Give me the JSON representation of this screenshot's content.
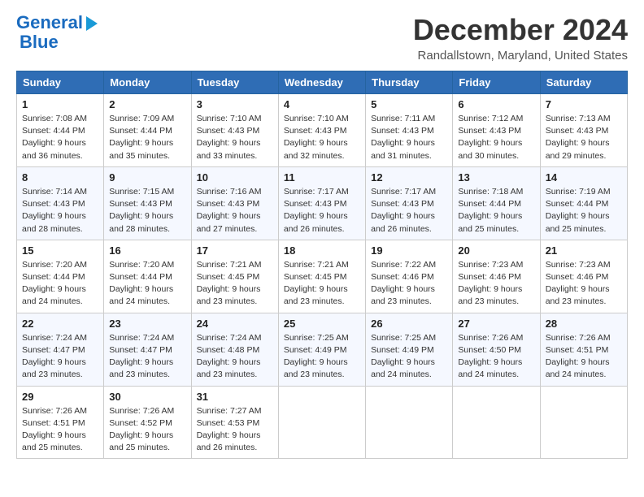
{
  "header": {
    "logo_line1": "General",
    "logo_line2": "Blue",
    "month_year": "December 2024",
    "location": "Randallstown, Maryland, United States"
  },
  "days_of_week": [
    "Sunday",
    "Monday",
    "Tuesday",
    "Wednesday",
    "Thursday",
    "Friday",
    "Saturday"
  ],
  "weeks": [
    [
      {
        "day": "1",
        "info": "Sunrise: 7:08 AM\nSunset: 4:44 PM\nDaylight: 9 hours\nand 36 minutes."
      },
      {
        "day": "2",
        "info": "Sunrise: 7:09 AM\nSunset: 4:44 PM\nDaylight: 9 hours\nand 35 minutes."
      },
      {
        "day": "3",
        "info": "Sunrise: 7:10 AM\nSunset: 4:43 PM\nDaylight: 9 hours\nand 33 minutes."
      },
      {
        "day": "4",
        "info": "Sunrise: 7:10 AM\nSunset: 4:43 PM\nDaylight: 9 hours\nand 32 minutes."
      },
      {
        "day": "5",
        "info": "Sunrise: 7:11 AM\nSunset: 4:43 PM\nDaylight: 9 hours\nand 31 minutes."
      },
      {
        "day": "6",
        "info": "Sunrise: 7:12 AM\nSunset: 4:43 PM\nDaylight: 9 hours\nand 30 minutes."
      },
      {
        "day": "7",
        "info": "Sunrise: 7:13 AM\nSunset: 4:43 PM\nDaylight: 9 hours\nand 29 minutes."
      }
    ],
    [
      {
        "day": "8",
        "info": "Sunrise: 7:14 AM\nSunset: 4:43 PM\nDaylight: 9 hours\nand 28 minutes."
      },
      {
        "day": "9",
        "info": "Sunrise: 7:15 AM\nSunset: 4:43 PM\nDaylight: 9 hours\nand 28 minutes."
      },
      {
        "day": "10",
        "info": "Sunrise: 7:16 AM\nSunset: 4:43 PM\nDaylight: 9 hours\nand 27 minutes."
      },
      {
        "day": "11",
        "info": "Sunrise: 7:17 AM\nSunset: 4:43 PM\nDaylight: 9 hours\nand 26 minutes."
      },
      {
        "day": "12",
        "info": "Sunrise: 7:17 AM\nSunset: 4:43 PM\nDaylight: 9 hours\nand 26 minutes."
      },
      {
        "day": "13",
        "info": "Sunrise: 7:18 AM\nSunset: 4:44 PM\nDaylight: 9 hours\nand 25 minutes."
      },
      {
        "day": "14",
        "info": "Sunrise: 7:19 AM\nSunset: 4:44 PM\nDaylight: 9 hours\nand 25 minutes."
      }
    ],
    [
      {
        "day": "15",
        "info": "Sunrise: 7:20 AM\nSunset: 4:44 PM\nDaylight: 9 hours\nand 24 minutes."
      },
      {
        "day": "16",
        "info": "Sunrise: 7:20 AM\nSunset: 4:44 PM\nDaylight: 9 hours\nand 24 minutes."
      },
      {
        "day": "17",
        "info": "Sunrise: 7:21 AM\nSunset: 4:45 PM\nDaylight: 9 hours\nand 23 minutes."
      },
      {
        "day": "18",
        "info": "Sunrise: 7:21 AM\nSunset: 4:45 PM\nDaylight: 9 hours\nand 23 minutes."
      },
      {
        "day": "19",
        "info": "Sunrise: 7:22 AM\nSunset: 4:46 PM\nDaylight: 9 hours\nand 23 minutes."
      },
      {
        "day": "20",
        "info": "Sunrise: 7:23 AM\nSunset: 4:46 PM\nDaylight: 9 hours\nand 23 minutes."
      },
      {
        "day": "21",
        "info": "Sunrise: 7:23 AM\nSunset: 4:46 PM\nDaylight: 9 hours\nand 23 minutes."
      }
    ],
    [
      {
        "day": "22",
        "info": "Sunrise: 7:24 AM\nSunset: 4:47 PM\nDaylight: 9 hours\nand 23 minutes."
      },
      {
        "day": "23",
        "info": "Sunrise: 7:24 AM\nSunset: 4:47 PM\nDaylight: 9 hours\nand 23 minutes."
      },
      {
        "day": "24",
        "info": "Sunrise: 7:24 AM\nSunset: 4:48 PM\nDaylight: 9 hours\nand 23 minutes."
      },
      {
        "day": "25",
        "info": "Sunrise: 7:25 AM\nSunset: 4:49 PM\nDaylight: 9 hours\nand 23 minutes."
      },
      {
        "day": "26",
        "info": "Sunrise: 7:25 AM\nSunset: 4:49 PM\nDaylight: 9 hours\nand 24 minutes."
      },
      {
        "day": "27",
        "info": "Sunrise: 7:26 AM\nSunset: 4:50 PM\nDaylight: 9 hours\nand 24 minutes."
      },
      {
        "day": "28",
        "info": "Sunrise: 7:26 AM\nSunset: 4:51 PM\nDaylight: 9 hours\nand 24 minutes."
      }
    ],
    [
      {
        "day": "29",
        "info": "Sunrise: 7:26 AM\nSunset: 4:51 PM\nDaylight: 9 hours\nand 25 minutes."
      },
      {
        "day": "30",
        "info": "Sunrise: 7:26 AM\nSunset: 4:52 PM\nDaylight: 9 hours\nand 25 minutes."
      },
      {
        "day": "31",
        "info": "Sunrise: 7:27 AM\nSunset: 4:53 PM\nDaylight: 9 hours\nand 26 minutes."
      },
      null,
      null,
      null,
      null
    ]
  ]
}
